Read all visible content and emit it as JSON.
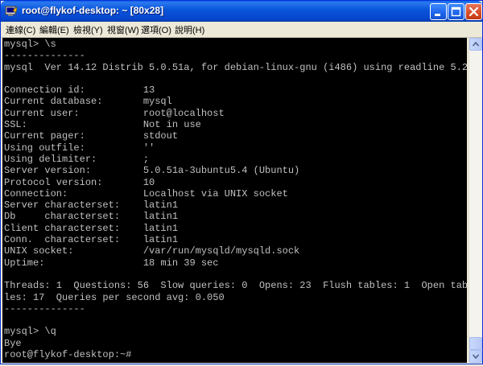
{
  "window": {
    "title": "root@flykof-desktop: ~ [80x28]",
    "icons": {
      "app": "putty-terminal-icon",
      "minimize": "minimize-icon",
      "maximize": "maximize-icon",
      "close": "close-icon"
    },
    "accent_color": "#0a57dc"
  },
  "menu": {
    "items": [
      {
        "label": "連線(C)"
      },
      {
        "label": "編輯(E)"
      },
      {
        "label": "檢視(Y)"
      },
      {
        "label": "視窗(W)"
      },
      {
        "label": "選項(O)"
      },
      {
        "label": "說明(H)"
      }
    ]
  },
  "terminal": {
    "background": "#000000",
    "foreground": "#c0c0c0",
    "lines": [
      "mysql> \\s",
      "--------------",
      "mysql  Ver 14.12 Distrib 5.0.51a, for debian-linux-gnu (i486) using readline 5.2",
      "",
      "Connection id:          13",
      "Current database:       mysql",
      "Current user:           root@localhost",
      "SSL:                    Not in use",
      "Current pager:          stdout",
      "Using outfile:          ''",
      "Using delimiter:        ;",
      "Server version:         5.0.51a-3ubuntu5.4 (Ubuntu)",
      "Protocol version:       10",
      "Connection:             Localhost via UNIX socket",
      "Server characterset:    latin1",
      "Db     characterset:    latin1",
      "Client characterset:    latin1",
      "Conn.  characterset:    latin1",
      "UNIX socket:            /var/run/mysqld/mysqld.sock",
      "Uptime:                 18 min 39 sec",
      "",
      "Threads: 1  Questions: 56  Slow queries: 0  Opens: 23  Flush tables: 1  Open tab",
      "les: 17  Queries per second avg: 0.050",
      "--------------",
      "",
      "mysql> \\q",
      "Bye",
      "root@flykof-desktop:~#"
    ]
  },
  "scrollbar": {
    "icons": {
      "up": "scroll-up-arrow-icon",
      "down": "scroll-down-arrow-icon"
    },
    "position_fraction": 1.0
  }
}
